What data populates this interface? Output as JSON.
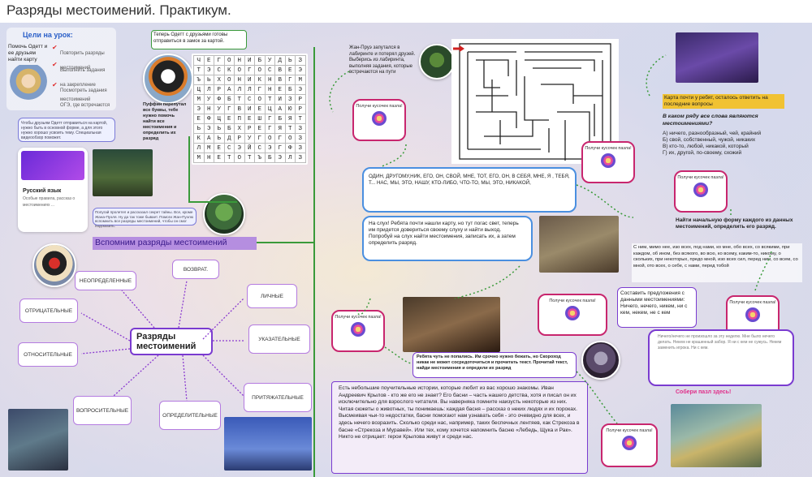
{
  "title": "Разряды местоимений. Практикум.",
  "goals": {
    "heading": "Цели на урок:",
    "main": "Помочь Одетт и ее друзьям найти карту",
    "items": [
      "Повторить разряды местоимений",
      "Выполнить задания на закрепление местоимений",
      "Посмотреть задания ОГЭ, где встречаются правописание местоимений"
    ]
  },
  "intro_note": "Чтобы друзьям Одетт отправиться на картой, нужно быть в основной форме, а для этого нужно хорошо усвоить тему. Специальная видеообзор поможет.",
  "video_card": {
    "title": "Русский язык",
    "sub": "Особые правила, рассказ о местоимениях ..."
  },
  "puffin_note": "Теперь Одетт с друзьями готовы отправиться в замок за картой.",
  "puffin_task": "Пуффин перепутал все буквы, тебе нужно помочь найти все местоимения и определить их разряд",
  "wordsearch": [
    [
      "Ч",
      "Е",
      "Г",
      "О",
      "Н",
      "И",
      "Б",
      "У",
      "Д",
      "Ь",
      "З"
    ],
    [
      "Т",
      "Э",
      "С",
      "К",
      "О",
      "Г",
      "О",
      "С",
      "В",
      "Е",
      "Э"
    ],
    [
      "Ъ",
      "Ь",
      "Х",
      "О",
      "Н",
      "И",
      "К",
      "Н",
      "В",
      "Г",
      "М"
    ],
    [
      "Ц",
      "Л",
      "Р",
      "А",
      "Л",
      "Л",
      "Г",
      "Н",
      "Е",
      "Б",
      "Э"
    ],
    [
      "М",
      "У",
      "Ф",
      "Б",
      "Т",
      "С",
      "О",
      "Т",
      "И",
      "З",
      "Р"
    ],
    [
      "Э",
      "Н",
      "У",
      "Г",
      "В",
      "И",
      "Е",
      "Ц",
      "А",
      "Ю",
      "Р"
    ],
    [
      "Е",
      "Ф",
      "Ц",
      "Е",
      "П",
      "Е",
      "Ш",
      "Г",
      "Б",
      "Я",
      "Т"
    ],
    [
      "Ь",
      "Э",
      "Ь",
      "Б",
      "Х",
      "Р",
      "Е",
      "Г",
      "Я",
      "Т",
      "З"
    ],
    [
      "К",
      "А",
      "Ь",
      "Д",
      "Р",
      "У",
      "Г",
      "О",
      "Г",
      "О",
      "З"
    ],
    [
      "Л",
      "М",
      "Е",
      "С",
      "Э",
      "Й",
      "С",
      "Э",
      "Г",
      "Ф",
      "З"
    ],
    [
      "М",
      "Н",
      "Е",
      "Т",
      "О",
      "Т",
      "Ъ",
      "Б",
      "Э",
      "Л",
      "З"
    ]
  ],
  "parrot_note": "Попугай пролетел и рассказал секрет тайны. Все, кроме Жана-Пуэля. Ну да так тоже бывает. Помоги Жан-Пуэлю вспомнить все разряды местоимений, чтобы он смог подсказать.",
  "section_heading": "Вспомним разряды местоимений",
  "mindmap": {
    "center": "Разряды местоимений",
    "nodes": [
      "НЕОПРЕДЕЛЕННЫЕ",
      "ВОЗВРАТ.",
      "ЛИЧНЫЕ",
      "ОТРИЦАТЕЛЬНЫЕ",
      "УКАЗАТЕЛЬНЫЕ",
      "ОТНОСИТЕЛЬНЫЕ",
      "ПРИТЯЖАТЕЛЬНЫЕ",
      "ВОПРОСИТЕЛЬНЫЕ",
      "ОПРЕДЕЛИТЕЛЬНЫЕ"
    ]
  },
  "frog_note": "Жан-Пруэ запутался в лабиринте и потерял друзей. Выберись из лабиринта, выполняя задания, которые встречаются на пути",
  "puzzle_label": "Получи кусочек пазла!",
  "pronoun_list": "ОДИН, ДРУГОМУ,НИК, ЕГО, ОН, СВОЙ, МНЕ, ТОТ, ЕГО, ОН, В СЕБЯ, МНЕ, Я , ТЕБЯ, Т... НАС, МЫ, ЭТО, НАШУ, КТО-ЛИБО, ЧТО-ТО, МЫ, ЭТО, НИКАКОЙ,",
  "listen_task": "На слух! Ребята почти нашли карту, но тут погас свет, теперь им придется довериться своему слуху и найти выход. Попробуй на слух найти местоимения, записать их, а затем определить разряд.",
  "map_note": "Карта почти у ребят, осталось ответить на последние вопросы",
  "quiz": {
    "question": "В каком ряду все слова являются местоимениями?",
    "options": [
      "А) ничего, разнообразный, чей, крайний",
      "Б) свой, собственный, чужой, никаких",
      "В) кто-то, любой, никакой, который",
      "Г) их, другой, по-своему, схожий"
    ]
  },
  "initial_form_task": "Найти начальную форму каждого из данных местоимений, определить его разряд.",
  "initial_form_words": "С ним, мимо нее, изо всех, под нами, ко мне, обо всех, со всякими, при каждом, об ином, без всякого, во всю, ко всему, каким-то, никому, о скольких, при некоторых, предо мной, изо всех сил, перед ним, со всем, со мной, ото всех, о себе, с нами, перед тобой",
  "compose_task": "Составить предложения с данными местоимениями: Ничего, нечего, никем, ни с кем, некем, не с кем",
  "editor_box": "Ничего/нечего не произошло за эту неделю. Мне было нечего делать. Некем не крашенный забор. Я ни с кем не сужусь. Некем заменить игрока. Ни с кем.",
  "escape_task": "Ребята чуть не попались. Им срочно нужно бежать, но Скороход никак не может сосредоточиться и прочитать текст. Прочитай текст, найди местоимения и определи их разряд",
  "collect_puzzle": "Собери пазл здесь!",
  "fable_text": "Есть небольшие поучительные истории, которые любит из вас хорошо знакомы. Иван Андреевич Крылов - кто же его не знает? Его басни – часть нашего детства, хотя и писал он их исключительно для взрослого читателя. Вы наверняка помните наизусть некоторые из них. Читая сюжеты о животных, ты понимаешь: каждая басня – рассказ о неких людях и их пороках. Высмеивая чьи-то недостатки, басни помогают нам узнавать себя - это очевидно для всех, и здесь нечего возразить. Сколько среди нас, например, таких беспечных лентяев, как Стрекоза в басне «Стрекоза и Муравей». Или тех, кому хочется напомнить басню «Лебедь, Щука и Рак». Никто не отрицает: герои Крылова живут и среди нас.",
  "colors": {
    "accent": "#7a3bd0",
    "green": "#3a9a3a",
    "pink": "#c8266e",
    "blue": "#4a8fe0",
    "yellow": "#f1c232"
  }
}
